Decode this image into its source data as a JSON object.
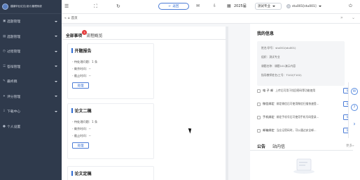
{
  "sidebar": {
    "brand": "建康毕业论文(设计)管理系统",
    "items": [
      {
        "icon": "file-icon",
        "glyph": "▣",
        "label": "选题管理"
      },
      {
        "icon": "list-icon",
        "glyph": "▤",
        "label": "选题管理"
      },
      {
        "icon": "process-icon",
        "glyph": "◷",
        "label": "过程管理"
      },
      {
        "icon": "defense-icon",
        "glyph": "☰",
        "label": "答辩管理"
      },
      {
        "icon": "archive-icon",
        "glyph": "✎",
        "label": "最终稿"
      },
      {
        "icon": "score-icon",
        "glyph": "✦",
        "label": "评分管理"
      },
      {
        "icon": "download-icon",
        "glyph": "⇩",
        "label": "下载中心"
      },
      {
        "icon": "user-icon",
        "glyph": "●",
        "label": "个人设置"
      }
    ]
  },
  "topbar": {
    "menu_icon": "☰",
    "fullscreen_icon": "⛶",
    "refresh_icon": "↻",
    "back_label": "返回",
    "back_icon": "←",
    "mail_icon": "✉",
    "download_icon": "⇩",
    "calendar_icon": "▦",
    "year": "2025届",
    "major": "测试专业",
    "user": "stu001[stu001]",
    "power_icon": "⏻"
  },
  "tabsbar": {
    "left_arrows": "«",
    "home_icon": "⌂",
    "home_label": "首页",
    "right_arrows": "»",
    "close_icon": "⌄"
  },
  "main": {
    "tab_all": "全部事项",
    "tab_all_badge": "3",
    "tab_flow": "流程概览",
    "tasks": [
      {
        "title": "开题报告",
        "line1": "- 待处理问题：1 条",
        "line2": "- 剩余时间：--",
        "line3": "- 截止时间：--",
        "button": "处理"
      },
      {
        "title": "论文二稿",
        "line1": "- 待处理问题：1 条",
        "line2": "- 剩余时间：--",
        "line3": "- 截止时间：--",
        "button": "处理"
      },
      {
        "title": "论文定稿"
      }
    ]
  },
  "right": {
    "title": "我的信息",
    "info": {
      "line1": "姓名/学号：stu001(stu001)",
      "line2": "组织：测试专业",
      "line3": "课题名称：课题101演示内容",
      "line4": "指导教师姓名/工号：T102(T102)"
    },
    "bindings": [
      {
        "label": "电 子 邮",
        "desc": "上传后可用于找回密码等功能使用",
        "button": "绑"
      },
      {
        "label": "微信绑定",
        "desc": "绑定微信后可使用微信扫描快速登...",
        "button": "绑"
      },
      {
        "label": "手机绑定",
        "desc": "绑定手机号后可使用手机号码登录...",
        "button": "绑"
      },
      {
        "label": "邮箱绑定",
        "desc": "当忘记密码时，可以通过安全邮...",
        "button": "绑"
      }
    ],
    "notice_tab1": "公告",
    "notice_tab2": "站内信",
    "more": "更多»"
  },
  "float_tools": {
    "chat_icon": "✉",
    "help_icon": "?",
    "expand_icon": "›"
  },
  "colors": {
    "sidebar_bg": "#2f3a4c",
    "accent": "#2f6bd1",
    "badge": "#e43b3b"
  }
}
